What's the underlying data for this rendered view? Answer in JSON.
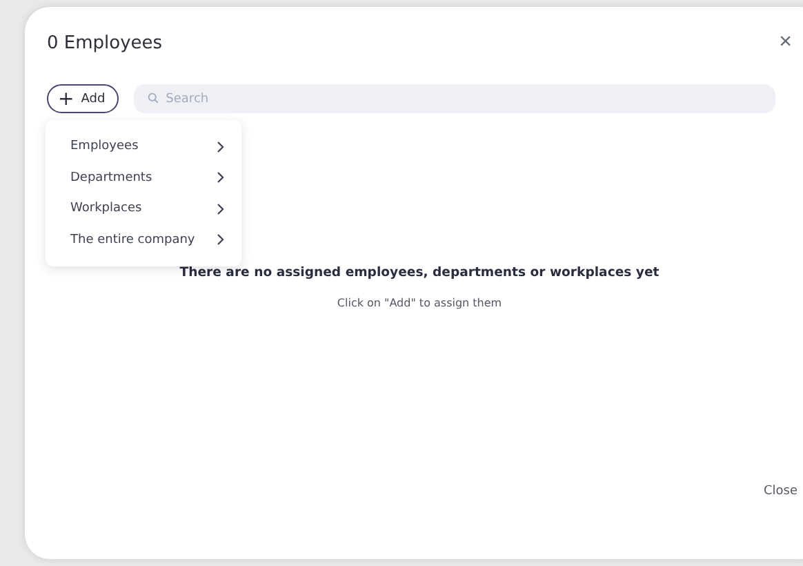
{
  "dialog": {
    "title": "0 Employees",
    "close_icon": "×",
    "add_button": {
      "icon": "+",
      "label": "Add"
    },
    "search": {
      "placeholder": "Search"
    },
    "add_menu": [
      {
        "label": "Employees"
      },
      {
        "label": "Departments"
      },
      {
        "label": "Workplaces"
      },
      {
        "label": "The entire company"
      }
    ],
    "empty_state": {
      "heading": "There are no assigned employees, departments or workplaces yet",
      "hint": "Click on \"Add\" to assign them"
    },
    "footer_button": "Close"
  }
}
